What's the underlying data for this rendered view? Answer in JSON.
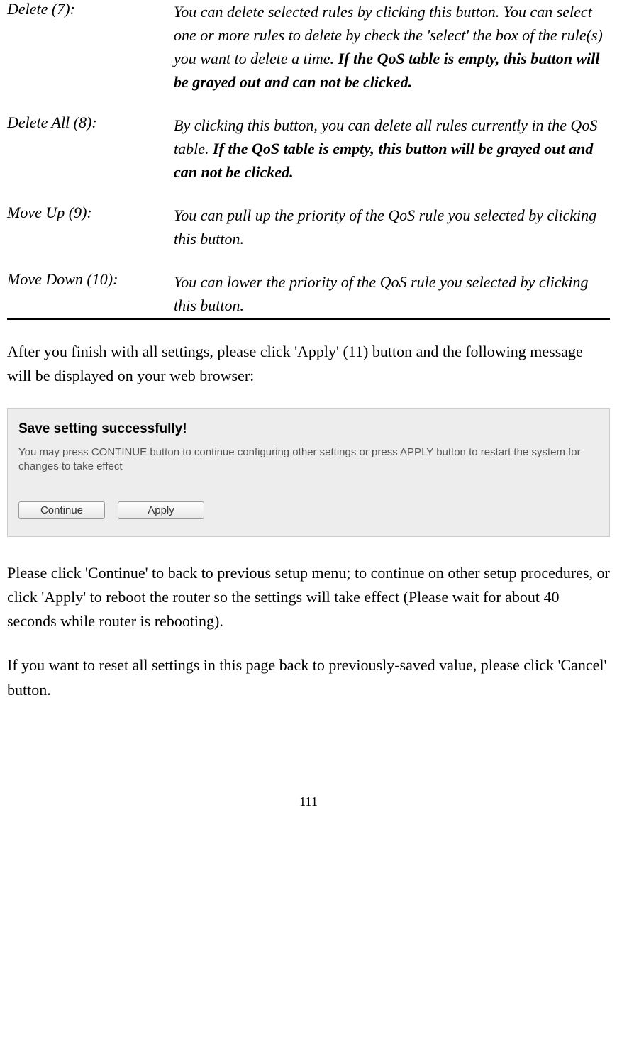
{
  "definitions": [
    {
      "term": "Delete (7):",
      "desc_pre": "You can delete selected rules by clicking this button. You can select one or more rules to delete by check the 'select' the box of the rule(s) you want to delete a time. ",
      "desc_bold": "If the QoS table is empty, this button will be grayed out and can not be clicked."
    },
    {
      "term": "Delete All (8):",
      "desc_pre": "By clicking this button, you can delete all rules currently in the QoS table. ",
      "desc_bold": "If the QoS table is empty, this button will be grayed out and can not be clicked."
    },
    {
      "term": "Move Up (9):",
      "desc_pre": "You can pull up the priority of the QoS rule you selected by clicking this button.",
      "desc_bold": ""
    },
    {
      "term": "Move Down (10):",
      "desc_pre": "You can lower the priority of the QoS rule you selected by clicking this button.",
      "desc_bold": ""
    }
  ],
  "para1": "After you finish with all settings, please click 'Apply' (11) button and the following message will be displayed on your web browser:",
  "screenshot": {
    "title": "Save setting successfully!",
    "message": "You may press CONTINUE button to continue configuring other settings or press APPLY button to restart the system for changes to take effect",
    "continue_label": "Continue",
    "apply_label": "Apply"
  },
  "para2": "Please click 'Continue' to back to previous setup menu; to continue on other setup procedures, or click 'Apply' to reboot the router so the settings will take effect (Please wait for about 40 seconds while router is rebooting).",
  "para3": "If you want to reset all settings in this page back to previously-saved value, please click 'Cancel' button.",
  "page_number": "111"
}
